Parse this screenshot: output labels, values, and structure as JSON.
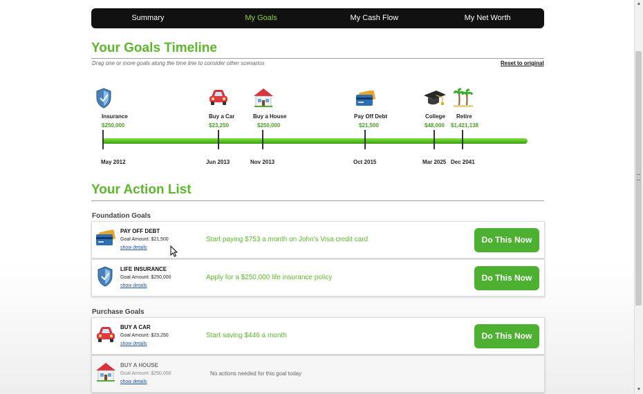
{
  "nav": {
    "tabs": [
      {
        "label": "Summary",
        "active": false
      },
      {
        "label": "My Goals",
        "active": true
      },
      {
        "label": "My Cash Flow",
        "active": false
      },
      {
        "label": "My Net Worth",
        "active": false
      }
    ]
  },
  "timeline": {
    "title": "Your Goals Timeline",
    "subtitle": "Drag one or more goals along the time line to consider other scenarios",
    "reset_label": "Reset to original",
    "milestones": [
      {
        "name": "Insurance",
        "amount": "$250,000",
        "date": "May 2012",
        "icon": "shield-icon"
      },
      {
        "name": "Buy a Car",
        "amount": "$23,250",
        "date": "Jun 2013",
        "icon": "car-icon"
      },
      {
        "name": "Buy a House",
        "amount": "$250,000",
        "date": "Nov 2013",
        "icon": "house-icon"
      },
      {
        "name": "Pay Off Debt",
        "amount": "$21,500",
        "date": "Oct 2015",
        "icon": "credit-card-icon"
      },
      {
        "name": "College",
        "amount": "$48,000",
        "date": "Mar 2025",
        "icon": "graduation-cap-icon"
      },
      {
        "name": "Retire",
        "amount": "$1,421,138",
        "date": "Dec 2041",
        "icon": "palm-tree-icon"
      }
    ],
    "bar_color": "#5cc02a"
  },
  "action_list": {
    "title": "Your Action List",
    "groups": [
      {
        "title": "Foundation Goals",
        "items": [
          {
            "title": "PAY OFF DEBT",
            "amount": "Goal Amount: $21,500",
            "details": "show details",
            "action": "Start paying $753 a month on John's Visa credit card",
            "button": "Do This Now",
            "icon": "credit-card-icon"
          },
          {
            "title": "LIFE INSURANCE",
            "amount": "Goal Amount: $250,000",
            "details": "show details",
            "action": "Apply for a $250,000 life insurance policy",
            "button": "Do This Now",
            "icon": "shield-icon"
          }
        ]
      },
      {
        "title": "Purchase Goals",
        "items": [
          {
            "title": "BUY A CAR",
            "amount": "Goal Amount: $23,250",
            "details": "show details",
            "action": "Start saving $446 a month",
            "button": "Do This Now",
            "icon": "car-icon"
          },
          {
            "title": "BUY A HOUSE",
            "amount": "Goal Amount: $250,000",
            "details": "show details",
            "action": "No actions needed for this goal today",
            "icon": "house-icon"
          }
        ]
      }
    ]
  },
  "colors": {
    "accent": "#5cb82a",
    "button": "#4db030",
    "nav_bg": "#111111",
    "nav_active": "#8fd22a"
  }
}
